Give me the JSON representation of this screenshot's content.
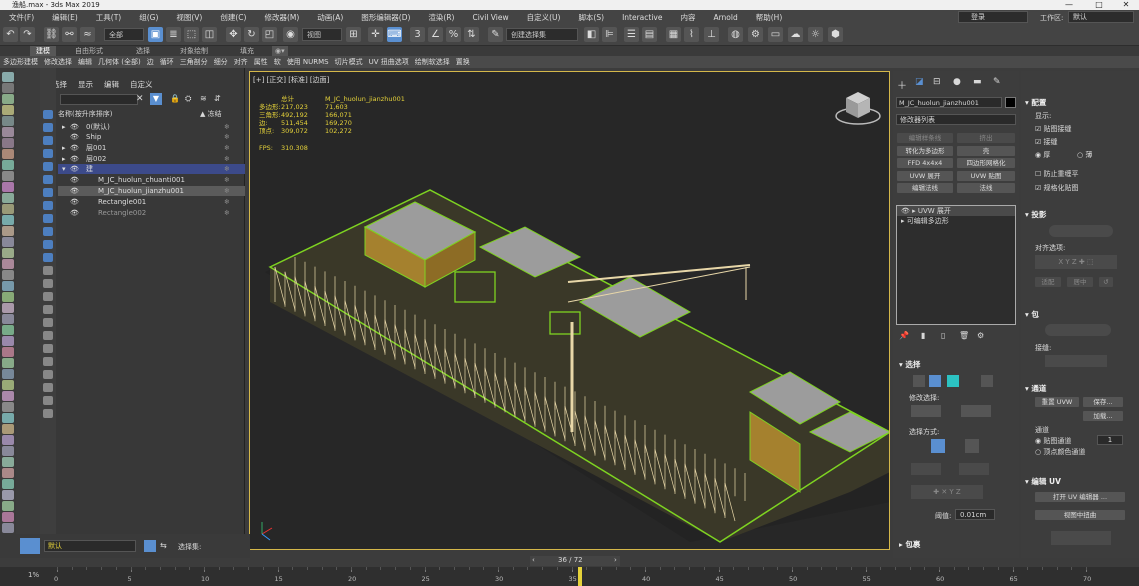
{
  "window": {
    "title": "渔船.max - 3ds Max 2019"
  },
  "menu": [
    "文件(F)",
    "编辑(E)",
    "工具(T)",
    "组(G)",
    "视图(V)",
    "创建(C)",
    "修改器(M)",
    "动画(A)",
    "图形编辑器(D)",
    "渲染(R)",
    "Civil View",
    "自定义(U)",
    "脚本(S)",
    "Interactive",
    "内容",
    "Arnold",
    "帮助(H)"
  ],
  "account": {
    "login": "登录",
    "workspace_label": "工作区:",
    "workspace_value": "默认"
  },
  "toolbar": {
    "filter": "全部",
    "coord": "视图",
    "selset": "创建选择集"
  },
  "ribbon_tabs": [
    "建模",
    "自由形式",
    "选择",
    "对象绘制",
    "填充"
  ],
  "ribbon_items": [
    "多边形建模",
    "修改选择",
    "编辑",
    "几何体 (全部)",
    "边",
    "循环",
    "三角剖分",
    "细分",
    "对齐",
    "属性",
    "软",
    "使用 NURMS",
    "切片模式",
    "UV 扭曲选项",
    "绘制软选择",
    "置换"
  ],
  "scene_explorer": {
    "tabs": [
      "选择",
      "显示",
      "编辑",
      "自定义"
    ],
    "col_name": "名称(按升序排序)",
    "col_freeze": "▲ 冻结",
    "rows": [
      {
        "name": "0(默认)"
      },
      {
        "name": "Ship"
      },
      {
        "name": "层001"
      },
      {
        "name": "层002"
      },
      {
        "name": "建"
      },
      {
        "name": "M_JC_huolun_chuanti001"
      },
      {
        "name": "M_JC_huolun_jianzhu001"
      },
      {
        "name": "Rectangle001"
      },
      {
        "name": "Rectangle002"
      }
    ]
  },
  "viewport": {
    "label": "[+] [正交] [标准] [边面]",
    "stats": {
      "header_total": "总计",
      "header_obj": "M_JC_huolun_jianzhu001",
      "rows": [
        {
          "label": "多边形:",
          "total": "217,023",
          "obj": "71,603"
        },
        {
          "label": "三角形:",
          "total": "492,192",
          "obj": "166,071"
        },
        {
          "label": "边:",
          "total": "511,454",
          "obj": "169,270"
        },
        {
          "label": "顶点:",
          "total": "309,072",
          "obj": "102,272"
        }
      ],
      "fps_label": "FPS:",
      "fps_value": "310.308"
    }
  },
  "command_panel": {
    "object_name": "M_JC_huolun_jianzhu001",
    "modifier_list": "修改器列表",
    "buttons": [
      "编辑样条线",
      "挤出",
      "转化为多边形",
      "壳",
      "FFD 4x4x4",
      "四边形网格化",
      "UVW 展开",
      "UVW 贴图",
      "编辑法线",
      "法线"
    ],
    "stack": [
      "UVW 展开",
      "可编辑多边形"
    ],
    "select_header": "选择",
    "modify_select": "修改选择:",
    "select_by": "选择方式:",
    "threshold_label": "阈值:",
    "threshold_value": "0.01cm",
    "wrap_header": "包裹"
  },
  "right_panel": {
    "config": "配置",
    "display": "显示:",
    "opts": [
      "贴图接缝",
      "接缝",
      "厚",
      "薄",
      "防止重缠平",
      "规格化贴图"
    ],
    "projection": "投影",
    "align_opts": "对齐选项:",
    "fit": "适配",
    "center": "居中",
    "wrap": "包",
    "seams": "接缝:",
    "channel": "通道",
    "reset_uvw": "重置 UVW",
    "save": "保存...",
    "load": "加载...",
    "channel2": "通道",
    "map_channel": "贴图通道",
    "map_channel_value": "1",
    "vertex_color": "顶点颜色通道",
    "edit_uv": "编辑 UV",
    "open_uv_editor": "打开 UV 编辑器 ...",
    "tweak_in_view": "视图中扭曲"
  },
  "status": {
    "layer": "默认",
    "selset": "选择集:"
  },
  "nav": {
    "frame": "36 / 72"
  },
  "timeline": {
    "start": "1%",
    "ticks": [
      "0",
      "5",
      "10",
      "15",
      "20",
      "25",
      "30",
      "35",
      "40",
      "45",
      "50",
      "55",
      "60",
      "65",
      "70"
    ]
  },
  "colors": {
    "wire": "#7ed321",
    "struct": "#e8d7a8",
    "roof": "#a8a8a8",
    "accent": "#5a8fd0",
    "stats": "#e5d23a"
  }
}
